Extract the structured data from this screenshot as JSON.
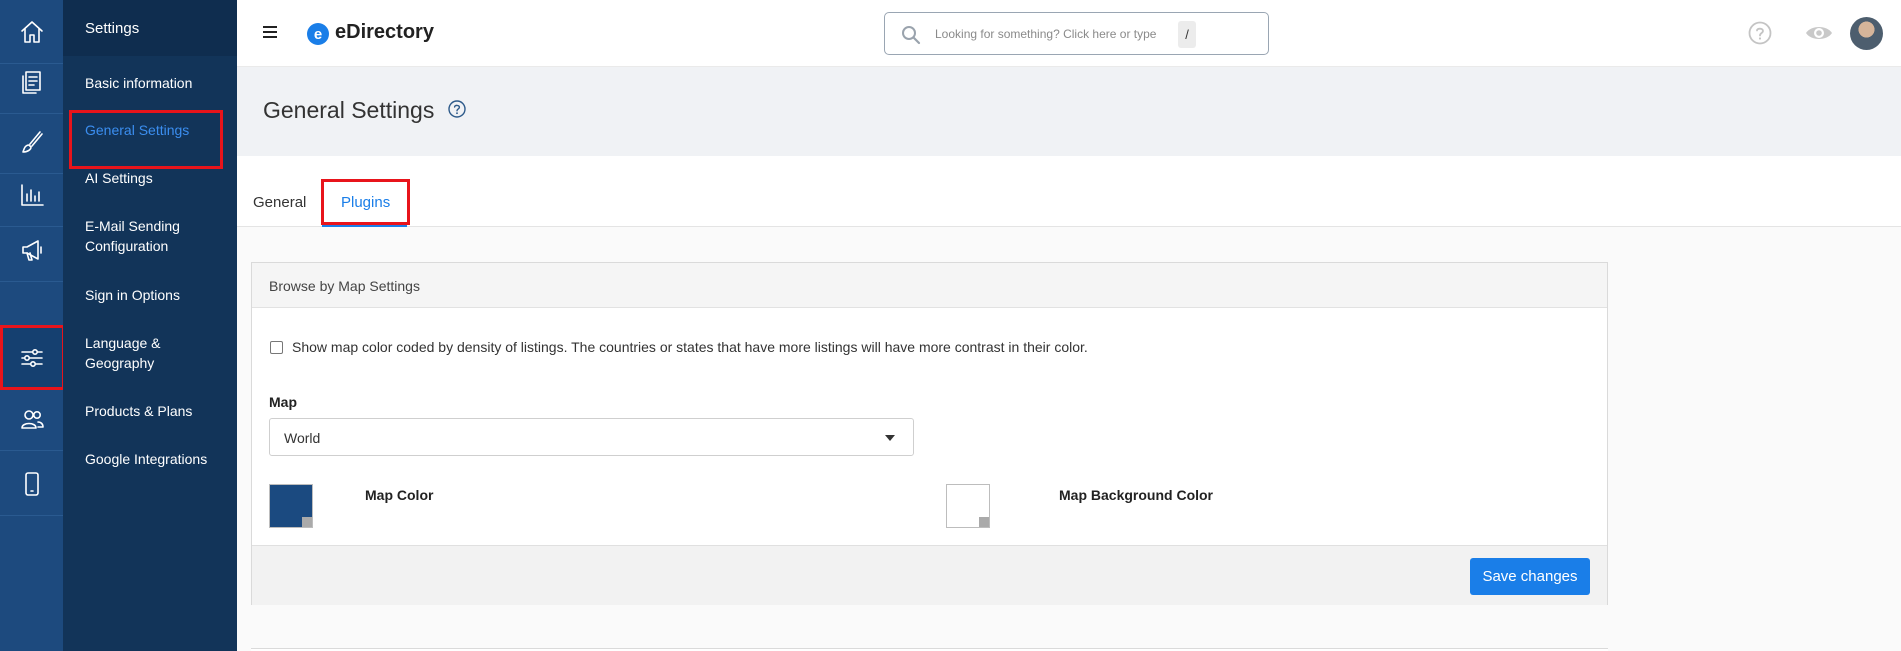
{
  "app": {
    "logo_letter": "e",
    "name": "eDirectory"
  },
  "rail": {
    "items": [
      {
        "icon": "home-icon"
      },
      {
        "icon": "content-icon"
      },
      {
        "icon": "design-brush-icon"
      },
      {
        "icon": "reports-chart-icon"
      },
      {
        "icon": "promote-megaphone-icon"
      },
      {
        "icon": "settings-sliders-icon",
        "active": true
      },
      {
        "icon": "users-icon"
      },
      {
        "icon": "mobile-icon"
      }
    ]
  },
  "submenu": {
    "title": "Settings",
    "items": [
      {
        "label": "Basic information"
      },
      {
        "label": "General Settings",
        "active": true
      },
      {
        "label": "AI Settings"
      },
      {
        "label": "E-Mail Sending Configuration"
      },
      {
        "label": "Sign in Options"
      },
      {
        "label": "Language & Geography"
      },
      {
        "label": "Products & Plans"
      },
      {
        "label": "Google Integrations"
      }
    ]
  },
  "search": {
    "placeholder": "Looking for something? Click here or type",
    "shortcut": "/"
  },
  "page": {
    "title": "General Settings"
  },
  "tabs": [
    {
      "label": "General"
    },
    {
      "label": "Plugins",
      "active": true
    }
  ],
  "browse_by_map": {
    "title": "Browse by Map Settings",
    "density_checkbox": {
      "label": "Show map color coded by density of listings. The countries or states that have more listings will have more contrast in their color.",
      "checked": false
    },
    "map_field": {
      "label": "Map",
      "value": "World"
    },
    "map_color": {
      "label": "Map Color",
      "value": "#1b4a80"
    },
    "map_background_color": {
      "label": "Map Background Color",
      "value": "#ffffff"
    },
    "save_label": "Save changes"
  },
  "colors": {
    "rail_bg": "#1d4a7e",
    "submenu_bg": "#123459",
    "accent": "#1a7ee8",
    "highlight": "#e8141b"
  }
}
